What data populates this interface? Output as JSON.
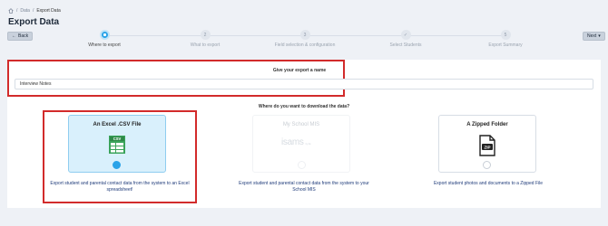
{
  "breadcrumb": {
    "items": [
      "Data",
      "Export Data"
    ]
  },
  "page": {
    "title": "Export Data"
  },
  "nav": {
    "back_label": "Back",
    "next_label": "Next"
  },
  "stepper": {
    "steps": [
      {
        "num": "1",
        "label": "Where to export",
        "state": "active"
      },
      {
        "num": "2",
        "label": "What to export",
        "state": "pending"
      },
      {
        "num": "3",
        "label": "Field selection & configuration",
        "state": "pending"
      },
      {
        "num": "4",
        "label": "Select Students",
        "state": "pending"
      },
      {
        "num": "5",
        "label": "Export Summary",
        "state": "pending"
      }
    ]
  },
  "export_name": {
    "label": "Give your export a name",
    "value": "Interview Notes"
  },
  "download": {
    "question": "Where do you want to download the data?",
    "options": [
      {
        "title": "An Excel .CSV File",
        "icon": "csv-file-icon",
        "selected": true,
        "enabled": true,
        "description": "Export student and parental contact data from the system to an Excel spreadsheet!"
      },
      {
        "title": "My School MIS",
        "logo": "isams",
        "logo_sub": "by iris",
        "selected": false,
        "enabled": false,
        "description": "Export student and parental contact data from the system to your School MIS"
      },
      {
        "title": "A Zipped Folder",
        "icon": "zip-file-icon",
        "selected": false,
        "enabled": true,
        "description": "Export student photos and documents to a Zipped File"
      }
    ]
  },
  "colors": {
    "accent": "#2aa3e8",
    "highlight_border": "#d22b2b",
    "selected_card_bg": "#d9f0fc",
    "description_text": "#1f3b7a"
  }
}
